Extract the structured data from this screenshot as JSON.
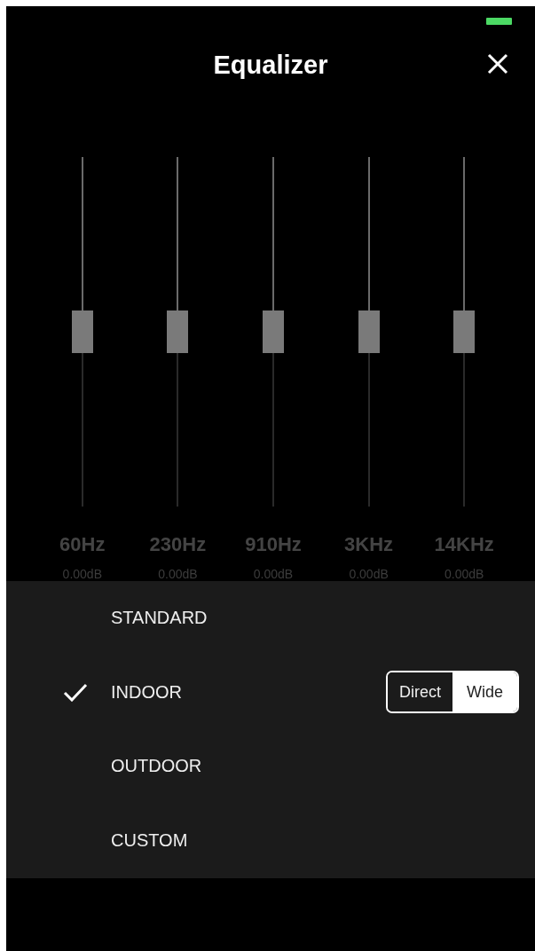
{
  "header": {
    "title": "Equalizer"
  },
  "bands": [
    {
      "frequency": "60Hz",
      "gain": "0.00dB",
      "level": 0.5
    },
    {
      "frequency": "230Hz",
      "gain": "0.00dB",
      "level": 0.5
    },
    {
      "frequency": "910Hz",
      "gain": "0.00dB",
      "level": 0.5
    },
    {
      "frequency": "3KHz",
      "gain": "0.00dB",
      "level": 0.5
    },
    {
      "frequency": "14KHz",
      "gain": "0.00dB",
      "level": 0.5
    }
  ],
  "presets": [
    {
      "label": "STANDARD",
      "selected": false
    },
    {
      "label": "INDOOR",
      "selected": true,
      "mode_switch": [
        {
          "label": "Direct",
          "selected": false
        },
        {
          "label": "Wide",
          "selected": true
        }
      ]
    },
    {
      "label": "OUTDOOR",
      "selected": false
    },
    {
      "label": "CUSTOM",
      "selected": false
    }
  ]
}
